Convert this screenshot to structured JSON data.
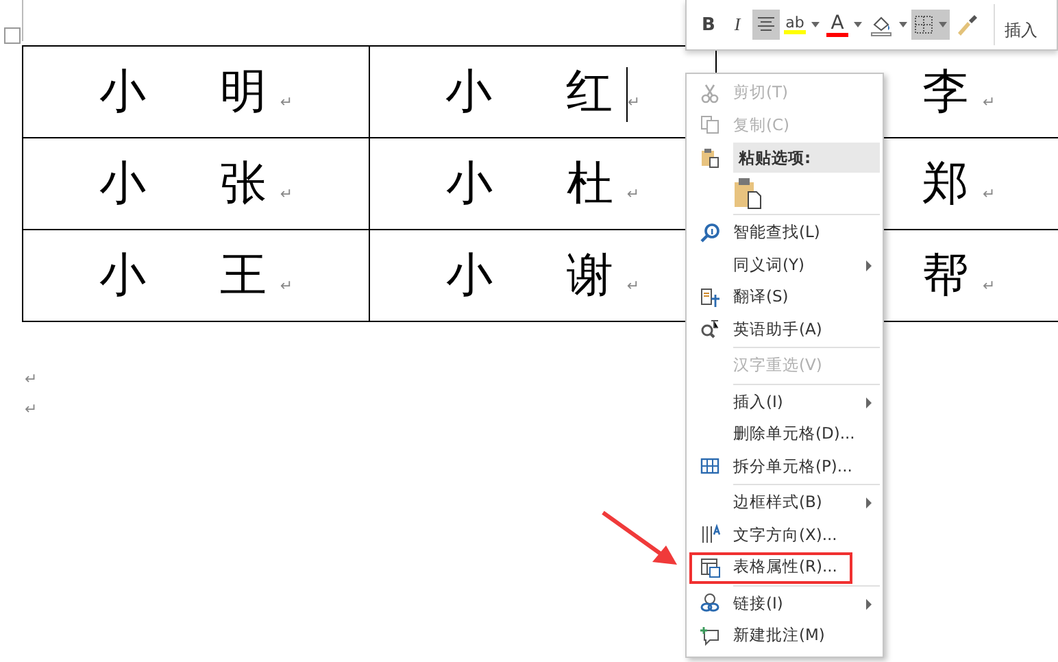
{
  "table": {
    "rows": [
      {
        "cells": [
          {
            "text": "小　明",
            "mark": "↵"
          },
          {
            "text": "小　红",
            "mark": "↵",
            "caret": true
          },
          {
            "text": "李",
            "mark": "↵"
          }
        ]
      },
      {
        "cells": [
          {
            "text": "小　张",
            "mark": "↵"
          },
          {
            "text": "小　杜",
            "mark": "↵",
            "caret": false
          },
          {
            "text": "郑",
            "mark": "↵"
          }
        ]
      },
      {
        "cells": [
          {
            "text": "小　王",
            "mark": "↵"
          },
          {
            "text": "小　谢",
            "mark": "↵",
            "caret": false
          },
          {
            "text": "帮",
            "mark": "↵"
          }
        ]
      }
    ]
  },
  "paragraphs": [
    {
      "mark": "↵"
    },
    {
      "mark": "↵"
    }
  ],
  "mini_toolbar": {
    "buttons": [
      {
        "kind": "bold",
        "label": "B",
        "selected": false,
        "dropdown": false
      },
      {
        "kind": "italic",
        "label": "I",
        "selected": false,
        "dropdown": false
      },
      {
        "kind": "align",
        "selected": true,
        "dropdown": false
      },
      {
        "kind": "highlight",
        "label": "ab",
        "color": "#ffff00",
        "selected": false,
        "dropdown": true
      },
      {
        "kind": "font-color",
        "label": "A",
        "color": "#ff0000",
        "selected": false,
        "dropdown": true
      },
      {
        "kind": "shading",
        "selected": false,
        "dropdown": true
      },
      {
        "kind": "borders",
        "selected": true,
        "dropdown": true
      },
      {
        "kind": "painter",
        "selected": false,
        "dropdown": false
      }
    ],
    "insert_label": "插入"
  },
  "context_menu": {
    "items": [
      {
        "kind": "item",
        "label": "剪切(T)",
        "disabled": true,
        "submenu": false,
        "highlighted": false
      },
      {
        "kind": "item",
        "label": "复制(C)",
        "disabled": true,
        "submenu": false,
        "highlighted": false
      },
      {
        "kind": "header",
        "label": "粘贴选项:"
      },
      {
        "kind": "paste"
      },
      {
        "kind": "separator"
      },
      {
        "kind": "item",
        "label": "智能查找(L)",
        "disabled": false,
        "submenu": false,
        "highlighted": false
      },
      {
        "kind": "item",
        "label": "同义词(Y)",
        "disabled": false,
        "submenu": true,
        "highlighted": false
      },
      {
        "kind": "item",
        "label": "翻译(S)",
        "disabled": false,
        "submenu": false,
        "highlighted": false
      },
      {
        "kind": "item",
        "label": "英语助手(A)",
        "disabled": false,
        "submenu": false,
        "highlighted": false
      },
      {
        "kind": "separator"
      },
      {
        "kind": "item",
        "label": "汉字重选(V)",
        "disabled": true,
        "submenu": false,
        "highlighted": false
      },
      {
        "kind": "separator"
      },
      {
        "kind": "item",
        "label": "插入(I)",
        "disabled": false,
        "submenu": true,
        "highlighted": false
      },
      {
        "kind": "item",
        "label": "删除单元格(D)...",
        "disabled": false,
        "submenu": false,
        "highlighted": false
      },
      {
        "kind": "item",
        "label": "拆分单元格(P)...",
        "disabled": false,
        "submenu": false,
        "highlighted": false
      },
      {
        "kind": "separator"
      },
      {
        "kind": "item",
        "label": "边框样式(B)",
        "disabled": false,
        "submenu": true,
        "highlighted": false
      },
      {
        "kind": "item",
        "label": "文字方向(X)...",
        "disabled": false,
        "submenu": false,
        "highlighted": false
      },
      {
        "kind": "item",
        "label": "表格属性(R)...",
        "disabled": false,
        "submenu": false,
        "highlighted": true
      },
      {
        "kind": "separator"
      },
      {
        "kind": "item",
        "label": "链接(I)",
        "disabled": false,
        "submenu": true,
        "highlighted": false
      },
      {
        "kind": "item",
        "label": "新建批注(M)",
        "disabled": false,
        "submenu": false,
        "highlighted": false
      }
    ]
  }
}
